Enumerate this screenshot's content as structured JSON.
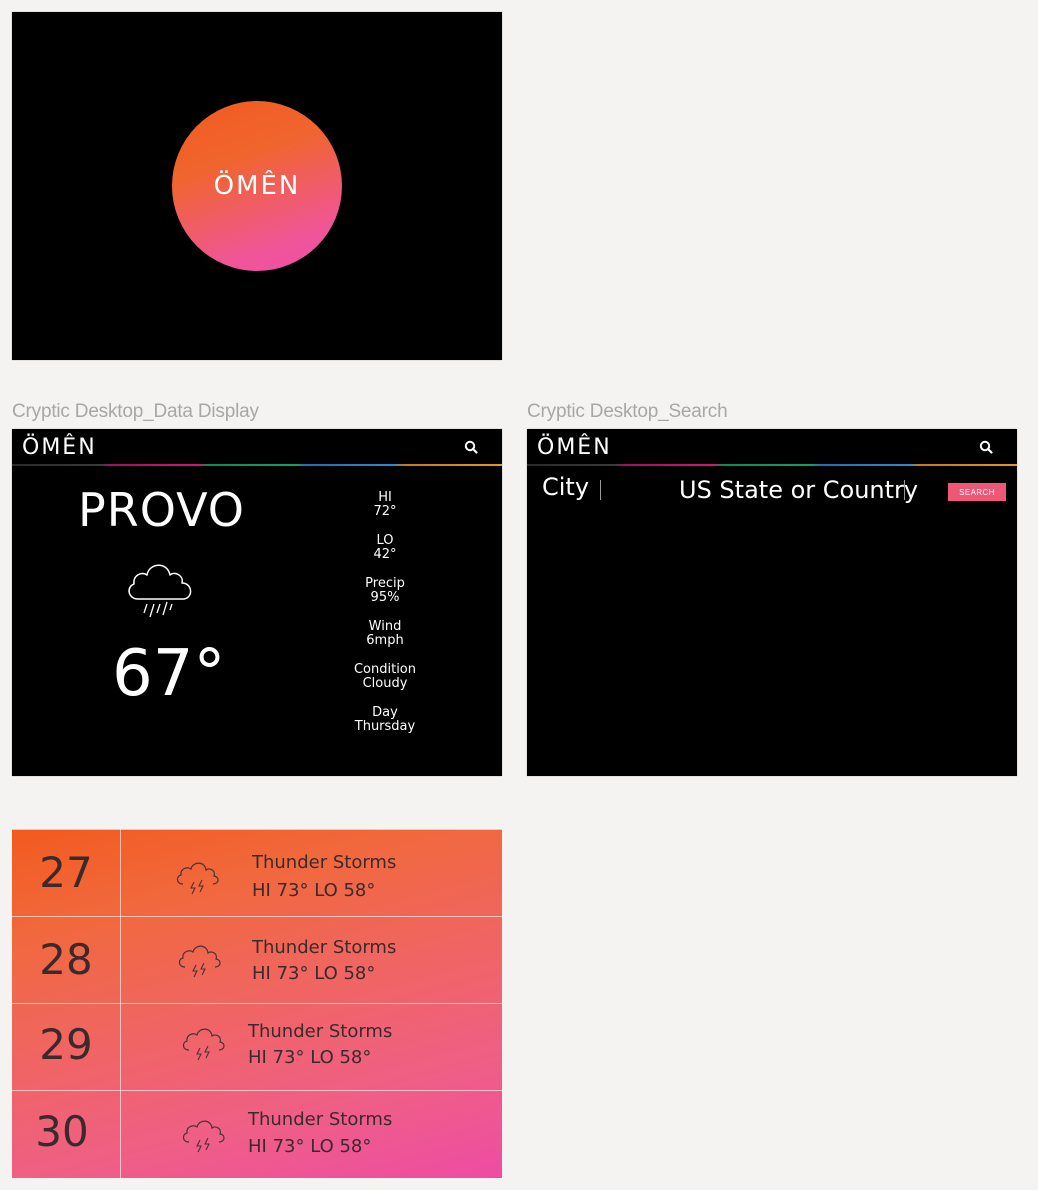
{
  "splash": {
    "logo": "ÖMÊN"
  },
  "data_display": {
    "board_label": "Cryptic Desktop_Data Display",
    "logo": "ÖMÊN",
    "city": "PROVO",
    "temperature": "67°",
    "weather_icon": "cloud-rain-icon",
    "stats": [
      {
        "label": "HI",
        "value": "72°"
      },
      {
        "label": "LO",
        "value": "42°"
      },
      {
        "label": "Precip",
        "value": "95%"
      },
      {
        "label": "Wind",
        "value": "6mph"
      },
      {
        "label": "Condition",
        "value": "Cloudy"
      },
      {
        "label": "Day",
        "value": "Thursday"
      }
    ]
  },
  "search_screen": {
    "board_label": "Cryptic Desktop_Search",
    "logo": "ÖMÊN",
    "city_placeholder": "City",
    "state_placeholder": "US State or Country",
    "search_button": "SEARCH"
  },
  "forecast": {
    "rows": [
      {
        "day": "27",
        "condition": "Thunder Storms",
        "hilo": "HI 73°  LO 58°",
        "icon": "cloud-lightning-icon"
      },
      {
        "day": "28",
        "condition": "Thunder Storms",
        "hilo": "HI 73°  LO 58°",
        "icon": "cloud-lightning-icon"
      },
      {
        "day": "29",
        "condition": "Thunder Storms",
        "hilo": "HI 73°  LO 58°",
        "icon": "cloud-lightning-icon"
      },
      {
        "day": "30",
        "condition": "Thunder Storms",
        "hilo": "HI 73°  LO 58°",
        "icon": "cloud-lightning-icon"
      }
    ]
  },
  "colors": {
    "orange": "#f25a1f",
    "pink": "#ef4da8",
    "search_button": "#ef5776",
    "background": "#f4f3f1"
  }
}
